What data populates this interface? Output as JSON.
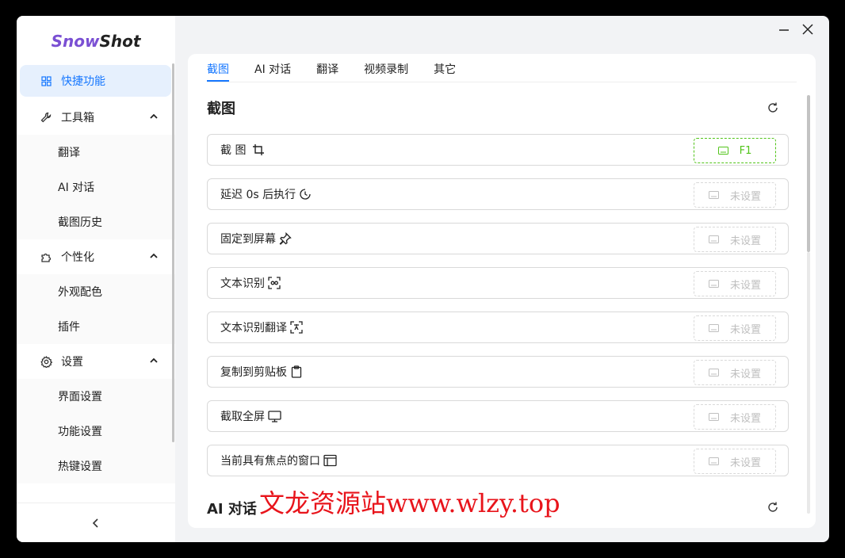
{
  "app": {
    "logo_a": "Snow",
    "logo_b": "Shot"
  },
  "sidebar": {
    "active": {
      "label": "快捷功能",
      "icon": "grid-icon"
    },
    "groups": [
      {
        "label": "工具箱",
        "icon": "wrench-icon",
        "items": [
          "翻译",
          "AI 对话",
          "截图历史"
        ]
      },
      {
        "label": "个性化",
        "icon": "puzzle-icon",
        "items": [
          "外观配色",
          "插件"
        ]
      },
      {
        "label": "设置",
        "icon": "gear-icon",
        "items": [
          "界面设置",
          "功能设置",
          "热键设置"
        ]
      }
    ],
    "collapse": "<"
  },
  "window": {
    "minimize": "—",
    "close": "✕"
  },
  "tabs": [
    "截图",
    "AI 对话",
    "翻译",
    "视频录制",
    "其它"
  ],
  "section": {
    "title": "截图",
    "title2": "AI 对话"
  },
  "rows": [
    {
      "label": "截 图",
      "icon": "crop-icon",
      "key": "F1",
      "set": true
    },
    {
      "label": "延迟 0s 后执行",
      "icon": "timer-icon",
      "key": "未设置",
      "set": false
    },
    {
      "label": "固定到屏幕",
      "icon": "pin-icon",
      "key": "未设置",
      "set": false
    },
    {
      "label": "文本识别",
      "icon": "scan-text-icon",
      "key": "未设置",
      "set": false
    },
    {
      "label": "文本识别翻译",
      "icon": "translate-scan-icon",
      "key": "未设置",
      "set": false
    },
    {
      "label": "复制到剪贴板",
      "icon": "clipboard-icon",
      "key": "未设置",
      "set": false
    },
    {
      "label": "截取全屏",
      "icon": "monitor-icon",
      "key": "未设置",
      "set": false
    },
    {
      "label": "当前具有焦点的窗口",
      "icon": "window-icon",
      "key": "未设置",
      "set": false
    }
  ],
  "watermark": "文龙资源站www.wlzy.top",
  "colors": {
    "accent": "#1677ff",
    "set_key": "#52c41a",
    "logo": "#7a4fd3",
    "watermark": "#e8141b"
  }
}
